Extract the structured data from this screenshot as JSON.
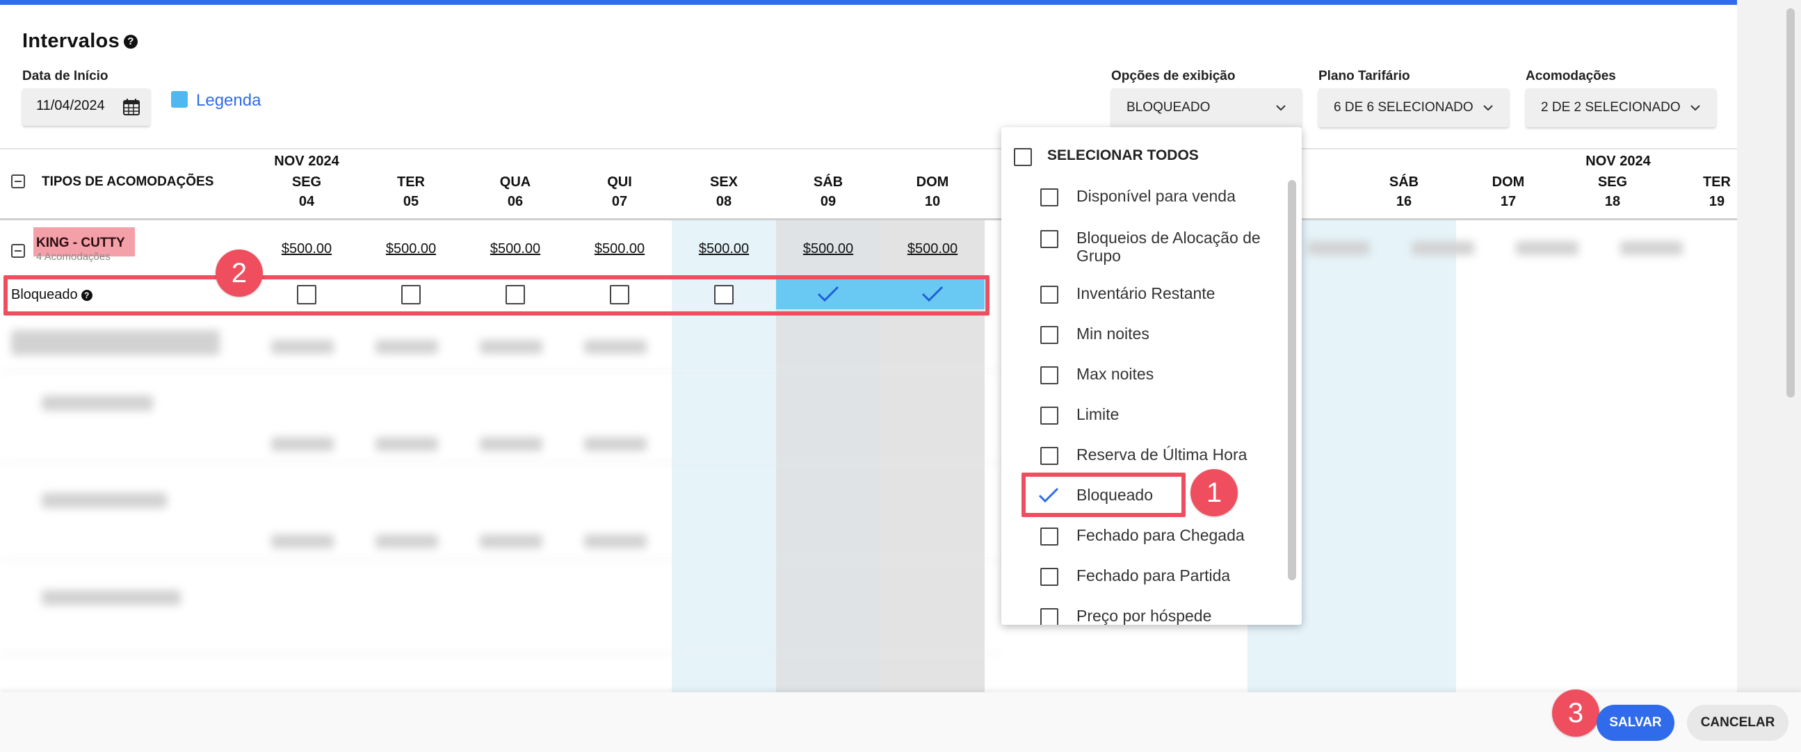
{
  "header": {
    "title": "Intervalos",
    "help_symbol": "?",
    "start_date_label": "Data de Início",
    "start_date_value": "11/04/2024",
    "legend_label": "Legenda",
    "display_options_label": "Opções de exibição",
    "display_options_value": "BLOQUEADO",
    "rate_plan_label": "Plano Tarifário",
    "rate_plan_value": "6 DE 6 SELECIONADO",
    "rooms_label": "Acomodações",
    "rooms_value": "2 DE 2 SELECIONADO"
  },
  "grid": {
    "room_types_header": "TIPOS DE ACOMODAÇÕES",
    "month_left": "NOV 2024",
    "month_right": "NOV 2024",
    "days_left": [
      {
        "dow": "SEG",
        "day": "04"
      },
      {
        "dow": "TER",
        "day": "05"
      },
      {
        "dow": "QUA",
        "day": "06"
      },
      {
        "dow": "QUI",
        "day": "07"
      },
      {
        "dow": "SEX",
        "day": "08"
      },
      {
        "dow": "SÁB",
        "day": "09"
      },
      {
        "dow": "DOM",
        "day": "10"
      }
    ],
    "days_right": [
      {
        "dow": "SÁB",
        "day": "16"
      },
      {
        "dow": "DOM",
        "day": "17"
      },
      {
        "dow": "SEG",
        "day": "18"
      },
      {
        "dow": "TER",
        "day": "19"
      }
    ],
    "room": {
      "name": "KING - CUTTY",
      "subtitle": "4 Acomodações",
      "prices": [
        "$500.00",
        "$500.00",
        "$500.00",
        "$500.00",
        "$500.00",
        "$500.00",
        "$500.00"
      ]
    },
    "blocked_row": {
      "label": "Bloqueado",
      "checked": [
        false,
        false,
        false,
        false,
        false,
        true,
        true
      ]
    }
  },
  "dropdown": {
    "select_all": "SELECIONAR TODOS",
    "items": [
      {
        "label": "Disponível para venda",
        "checked": false
      },
      {
        "label": "Bloqueios de Alocação de Grupo",
        "checked": false
      },
      {
        "label": "Inventário Restante",
        "checked": false
      },
      {
        "label": "Min noites",
        "checked": false
      },
      {
        "label": "Max noites",
        "checked": false
      },
      {
        "label": "Limite",
        "checked": false
      },
      {
        "label": "Reserva de Última Hora",
        "checked": false
      },
      {
        "label": "Bloqueado",
        "checked": true
      },
      {
        "label": "Fechado para Chegada",
        "checked": false
      },
      {
        "label": "Fechado para Partida",
        "checked": false
      },
      {
        "label": "Preço por hóspede",
        "checked": false
      }
    ]
  },
  "annotations": {
    "step1": "1",
    "step2": "2",
    "step3": "3"
  },
  "footer": {
    "save_label": "SALVAR",
    "cancel_label": "CANCELAR"
  },
  "colors": {
    "accent": "#2f6bea",
    "highlight": "#ef4e5e",
    "checked_cell": "#6ac9f3",
    "legend": "#4fb8f0"
  }
}
